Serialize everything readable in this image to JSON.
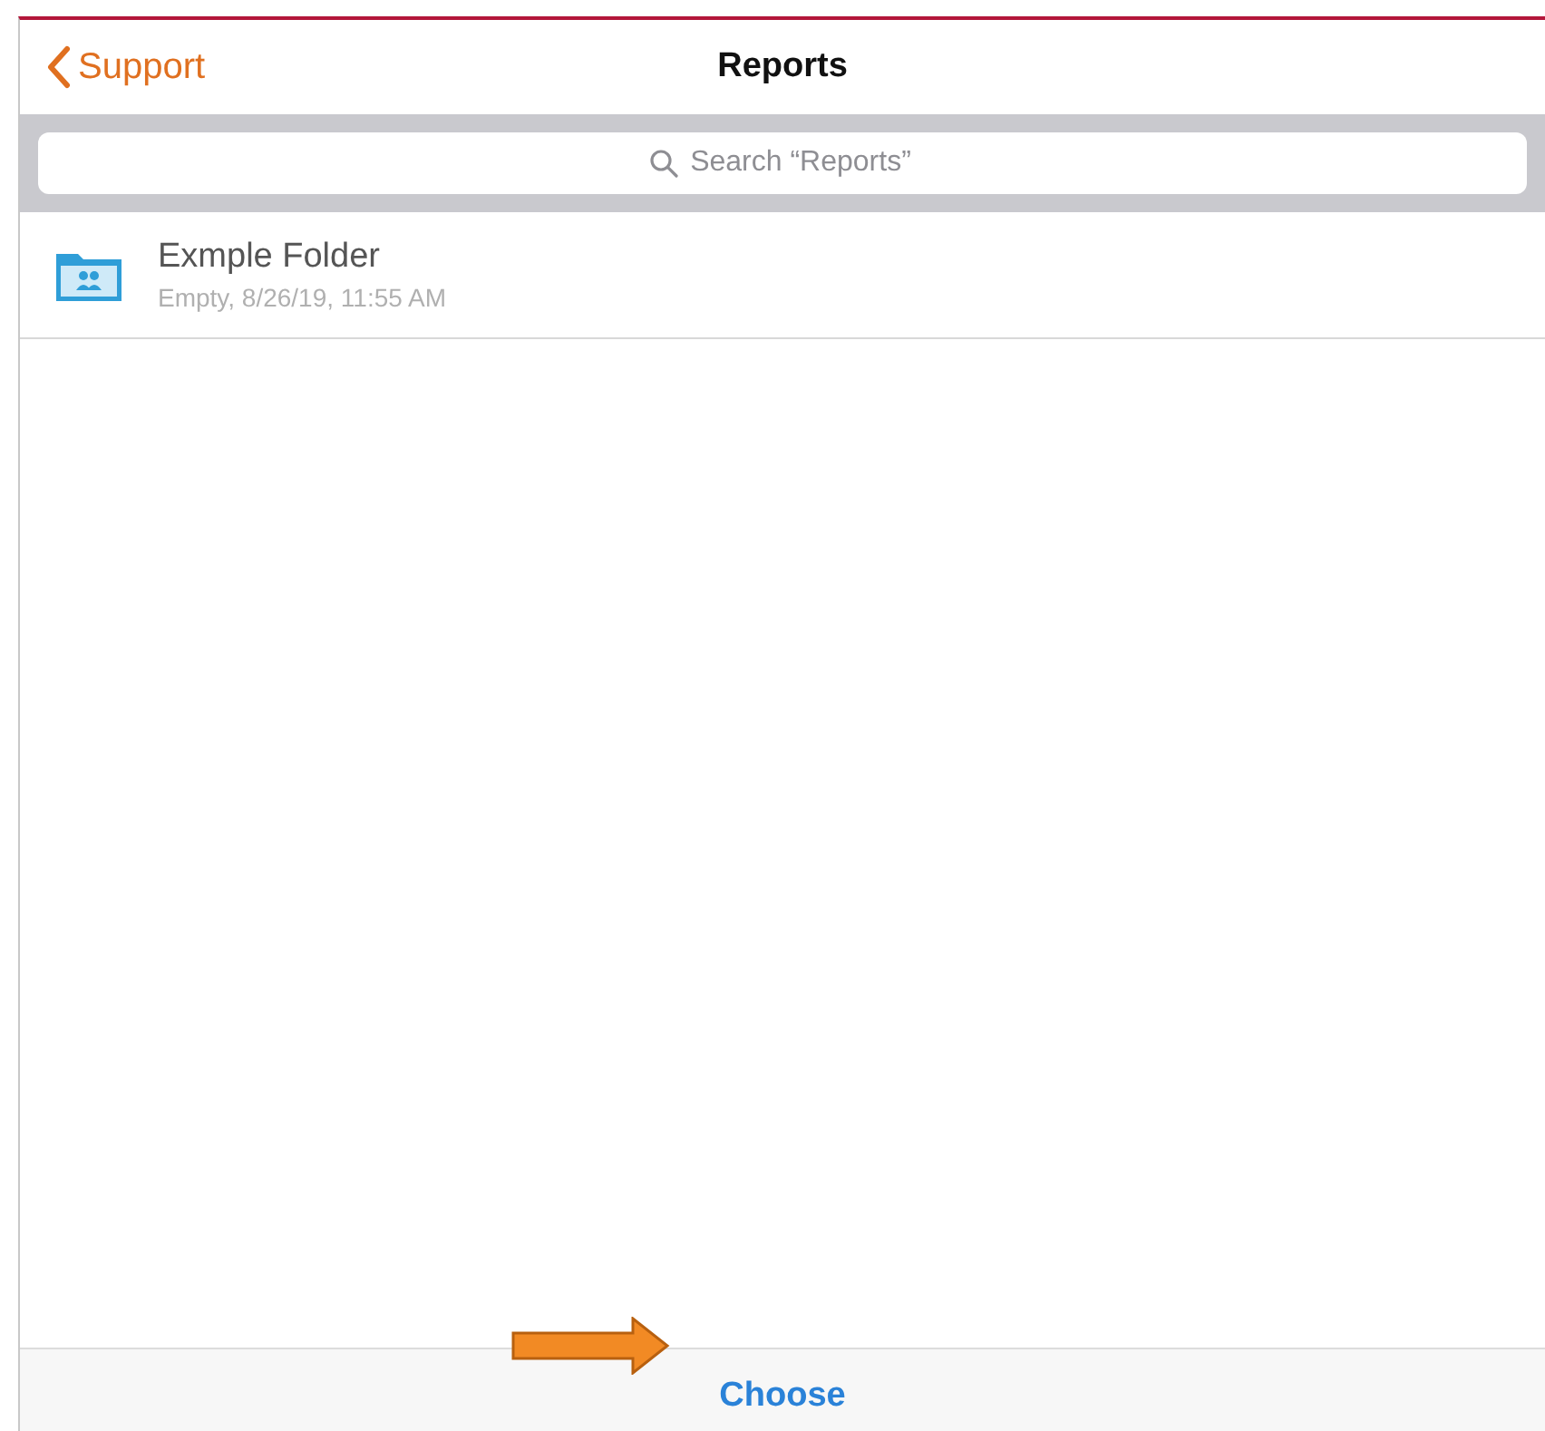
{
  "nav": {
    "back_label": "Support",
    "title": "Reports"
  },
  "search": {
    "placeholder": "Search “Reports”"
  },
  "items": [
    {
      "name": "Exmple Folder",
      "detail": "Empty, 8/26/19, 11:55 AM"
    }
  ],
  "footer": {
    "button": "Choose"
  }
}
